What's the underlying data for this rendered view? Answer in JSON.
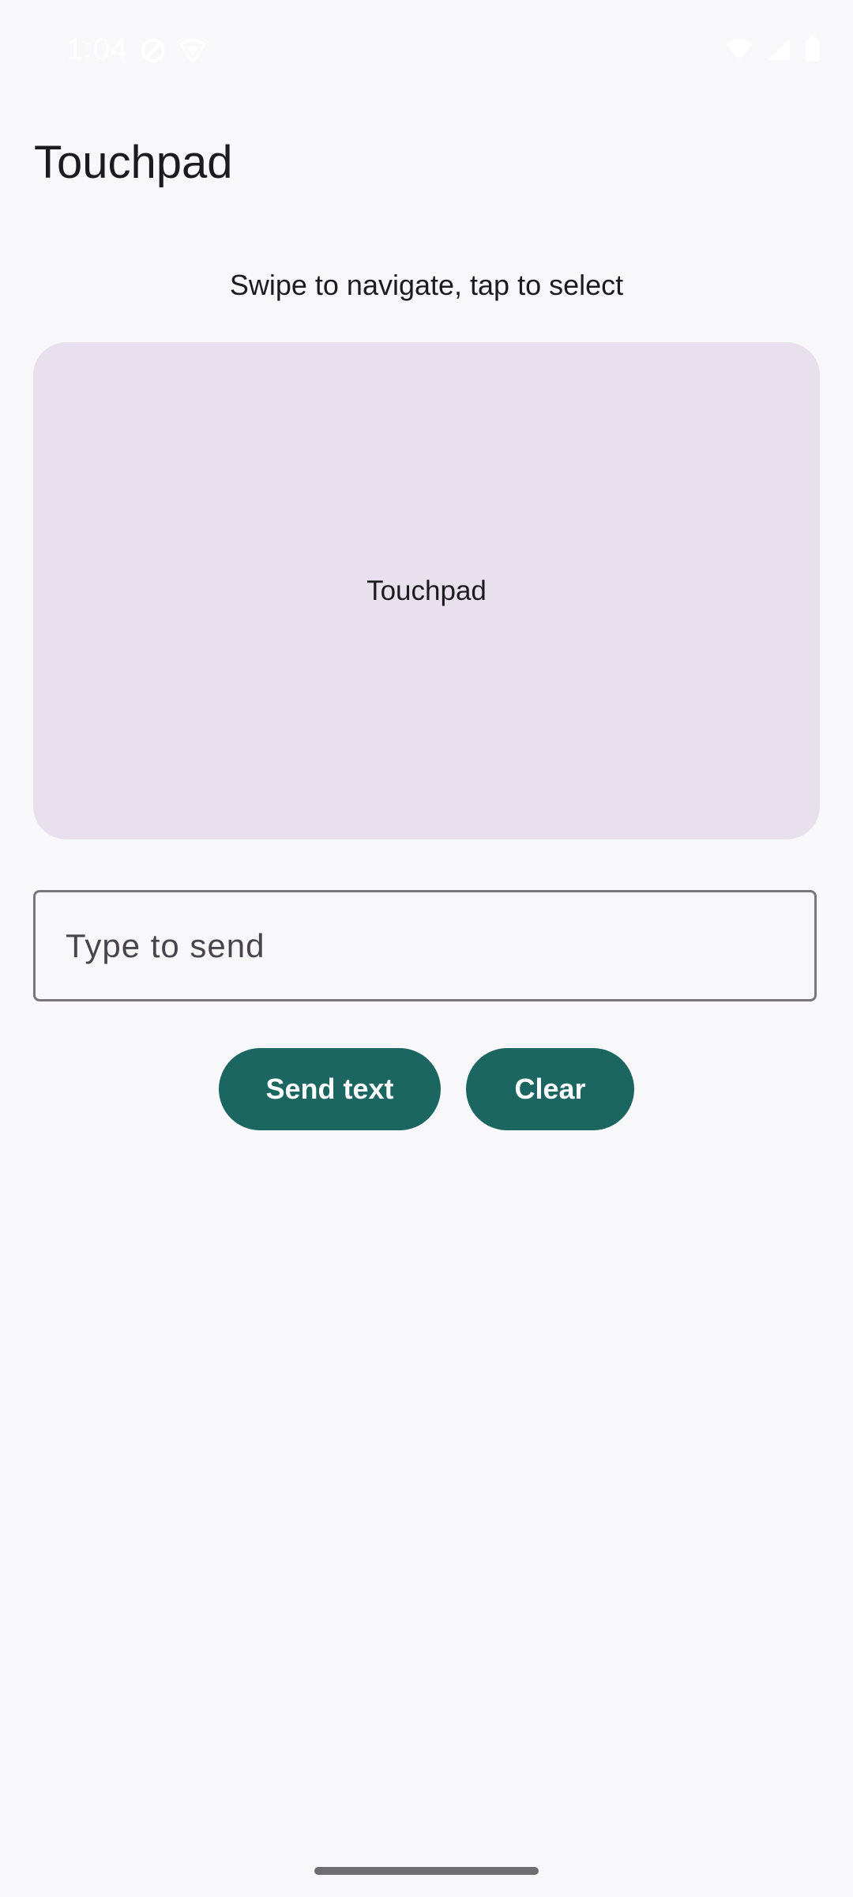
{
  "status_bar": {
    "time": "1:04",
    "icons": [
      "dnd-icon",
      "vpn-icon",
      "wifi-icon",
      "signal-icon",
      "battery-icon"
    ]
  },
  "app": {
    "title": "Touchpad"
  },
  "main": {
    "instructions": "Swipe to navigate, tap to select",
    "touchpad_label": "Touchpad",
    "text_input": {
      "value": "",
      "placeholder": "Type to send"
    },
    "buttons": {
      "send_label": "Send text",
      "clear_label": "Clear"
    }
  },
  "colors": {
    "background": "#f8f8fb",
    "touchpad": "#e8e0ec",
    "button": "#1c6661",
    "button_text": "#ffffff"
  }
}
